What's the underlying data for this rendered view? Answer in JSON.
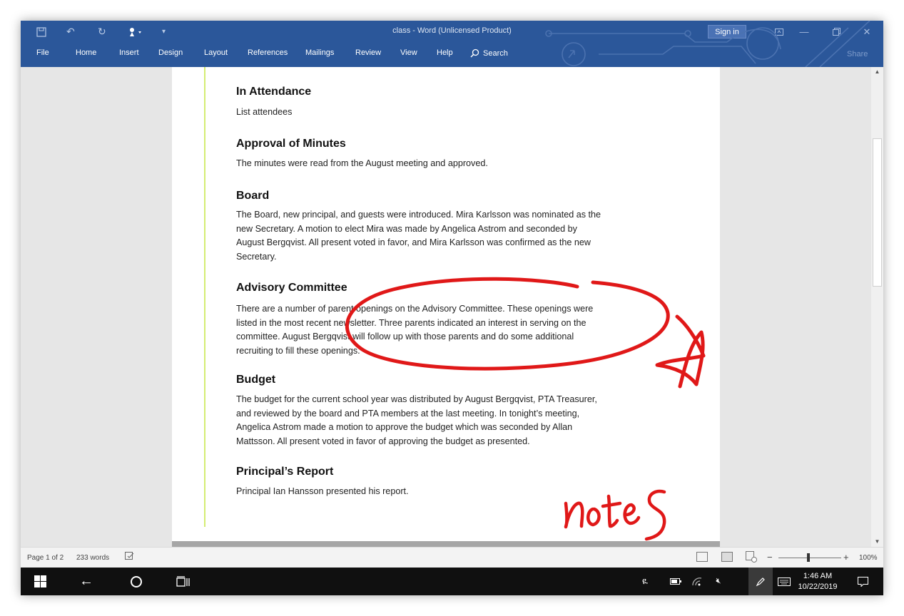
{
  "window": {
    "title": "class  -  Word (Unlicensed Product)",
    "sign_in": "Sign in",
    "share": "Share"
  },
  "ribbon": {
    "tabs": [
      "File",
      "Home",
      "Insert",
      "Design",
      "Layout",
      "References",
      "Mailings",
      "Review",
      "View",
      "Help"
    ],
    "search_label": "Search"
  },
  "document": {
    "sections": [
      {
        "heading": "In Attendance",
        "body": "List attendees"
      },
      {
        "heading": "Approval of Minutes",
        "body": "The minutes were read from the August meeting and approved."
      },
      {
        "heading": "Board",
        "body": "The Board, new principal, and guests were introduced. Mira Karlsson was nominated as the\nnew Secretary. A motion to elect Mira was made by Angelica Astrom and seconded by\nAugust Bergqvist. All present voted in favor, and Mira Karlsson was confirmed as the new\nSecretary."
      },
      {
        "heading": "Advisory Committee",
        "body": "There are a number of parent openings on the Advisory Committee. These openings were\nlisted in the most recent newsletter. Three parents indicated an interest in serving on the\ncommittee. August Bergqvist will follow up with those parents and do some additional\nrecruiting to fill these openings."
      },
      {
        "heading": "Budget",
        "body": "The budget for the current school year was distributed by August Bergqvist, PTA Treasurer,\nand reviewed by the board and PTA members at the last meeting. In tonight’s meeting,\nAngelica Astrom made a motion to approve the budget which was seconded by Allan\nMattsson. All present voted in favor of approving the budget as presented."
      },
      {
        "heading": "Principal’s Report",
        "body": "Principal Ian Hansson presented his report."
      }
    ],
    "ink_color": "#e01818"
  },
  "statusbar": {
    "page": "Page 1 of 2",
    "words": "233 words",
    "zoom": "100%",
    "zoom_minus": "−",
    "zoom_plus": "+"
  },
  "taskbar": {
    "time": "1:46 AM",
    "date": "10/22/2019"
  },
  "colors": {
    "word_blue": "#2b579a",
    "taskbar": "#101010"
  }
}
